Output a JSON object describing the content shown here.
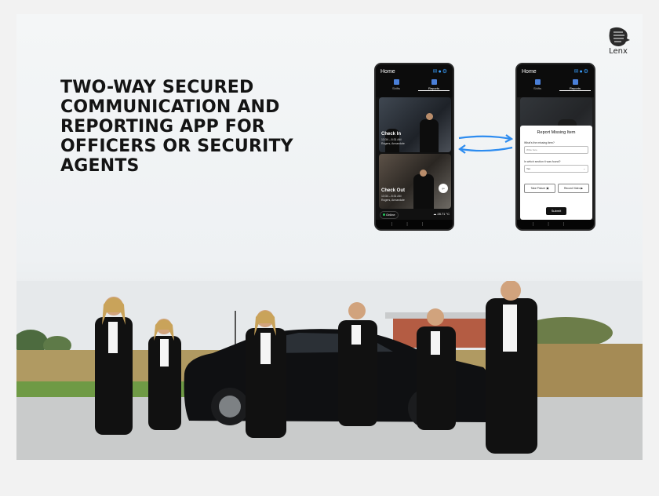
{
  "headline": "TWO-WAY SECURED COMMUNICATION AND REPORTING APP FOR OFFICERS OR SECURITY AGENTS",
  "logo": {
    "text": "Lenx"
  },
  "phone_left": {
    "title": "Home",
    "nav": [
      "Shifts",
      "Reports"
    ],
    "card1": {
      "title": "Check In",
      "time": "13:34 – 8:31 AM",
      "location": "Rogers, Annandale"
    },
    "card2": {
      "title": "Check Out",
      "time": "13:34 – 8:31 AM",
      "location": "Rogers, Annandale"
    },
    "go_label": "go",
    "status": "Online",
    "weather": "28.71 °C"
  },
  "phone_right": {
    "title": "Home",
    "nav": [
      "Shifts",
      "Reports"
    ],
    "modal": {
      "title": "Report Missing Item",
      "q1": "What's the missing item?",
      "q1_placeholder": "Write here",
      "q2": "In which section it was found?",
      "q2_value": "Yes",
      "take_picture": "Take Picture",
      "record_video": "Record Video",
      "submit": "Submit"
    }
  },
  "colors": {
    "accent": "#2d8cf0",
    "online": "#20c35a"
  }
}
